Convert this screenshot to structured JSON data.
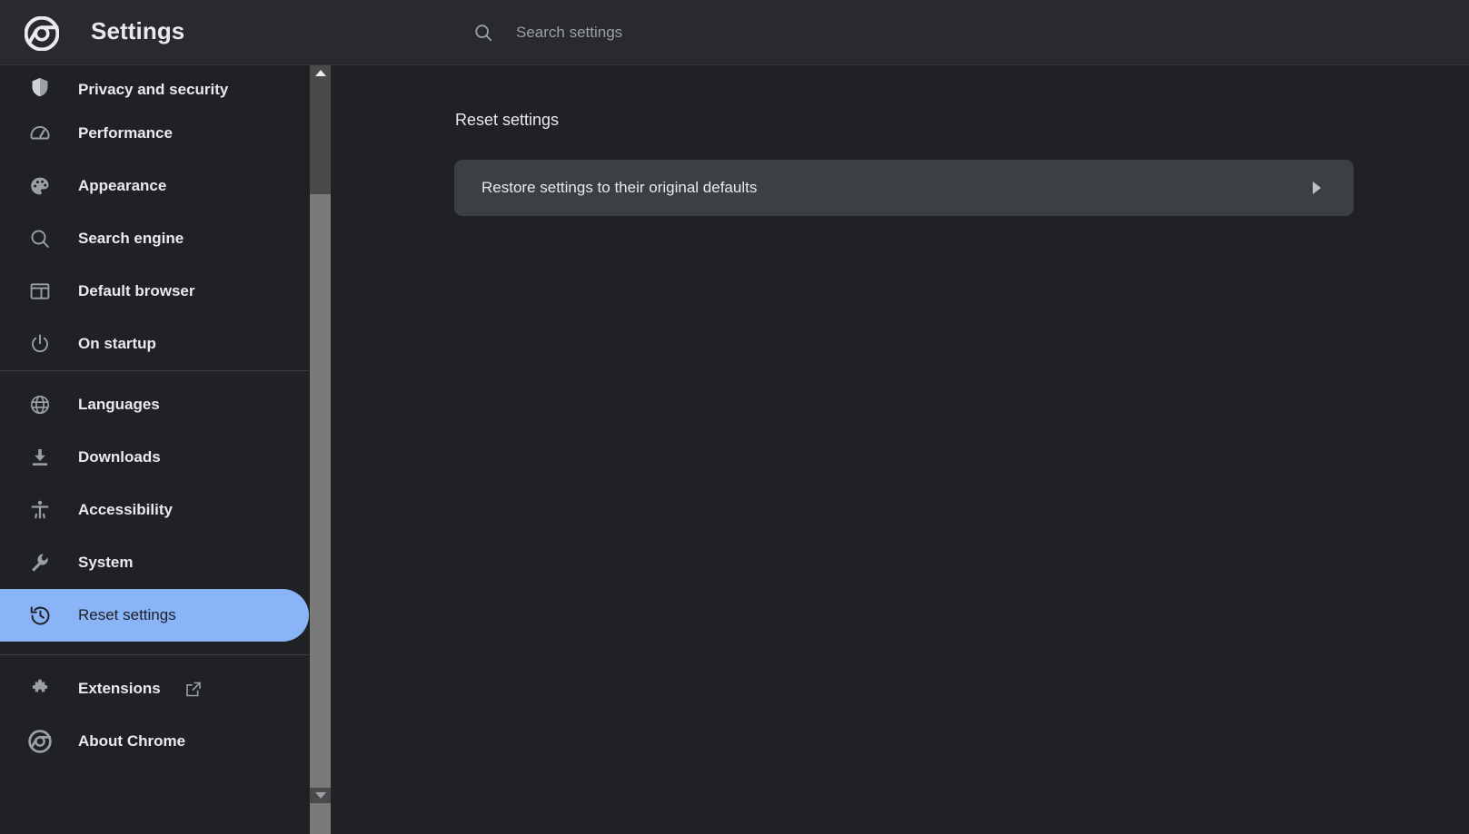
{
  "header": {
    "logo_icon": "chrome-logo-icon",
    "title": "Settings",
    "search": {
      "icon": "search-icon",
      "placeholder": "Search settings",
      "value": ""
    }
  },
  "sidebar": {
    "groups": [
      {
        "items": [
          {
            "icon": "shield-icon",
            "label": "Privacy and security",
            "selected": false,
            "external": false
          },
          {
            "icon": "gauge-icon",
            "label": "Performance",
            "selected": false,
            "external": false
          },
          {
            "icon": "palette-icon",
            "label": "Appearance",
            "selected": false,
            "external": false
          },
          {
            "icon": "search-icon",
            "label": "Search engine",
            "selected": false,
            "external": false
          },
          {
            "icon": "browser-icon",
            "label": "Default browser",
            "selected": false,
            "external": false
          },
          {
            "icon": "power-icon",
            "label": "On startup",
            "selected": false,
            "external": false
          }
        ]
      },
      {
        "items": [
          {
            "icon": "globe-icon",
            "label": "Languages",
            "selected": false,
            "external": false
          },
          {
            "icon": "download-icon",
            "label": "Downloads",
            "selected": false,
            "external": false
          },
          {
            "icon": "accessibility-icon",
            "label": "Accessibility",
            "selected": false,
            "external": false
          },
          {
            "icon": "wrench-icon",
            "label": "System",
            "selected": false,
            "external": false
          },
          {
            "icon": "history-icon",
            "label": "Reset settings",
            "selected": true,
            "external": false
          }
        ]
      },
      {
        "items": [
          {
            "icon": "puzzle-icon",
            "label": "Extensions",
            "selected": false,
            "external": true,
            "external_icon": "open-in-new-icon"
          },
          {
            "icon": "chrome-logo-icon",
            "label": "About Chrome",
            "selected": false,
            "external": false
          }
        ]
      }
    ],
    "scrollbar": {
      "up_icon": "scroll-up-arrow-icon",
      "down_icon": "scroll-down-arrow-icon"
    }
  },
  "main": {
    "section_title": "Reset settings",
    "card": {
      "label": "Restore settings to their original defaults",
      "chevron_icon": "chevron-right-icon"
    }
  },
  "colors": {
    "page_bg": "#202124",
    "header_bg": "#292a2d",
    "card_bg": "#3c4043",
    "accent": "#8ab4f8",
    "text_primary": "#e8eaed",
    "text_secondary": "#9aa0a6",
    "divider": "#3c4043",
    "scrollbar_track": "#4a4a4a",
    "scrollbar_thumb": "#7a7a7a"
  }
}
